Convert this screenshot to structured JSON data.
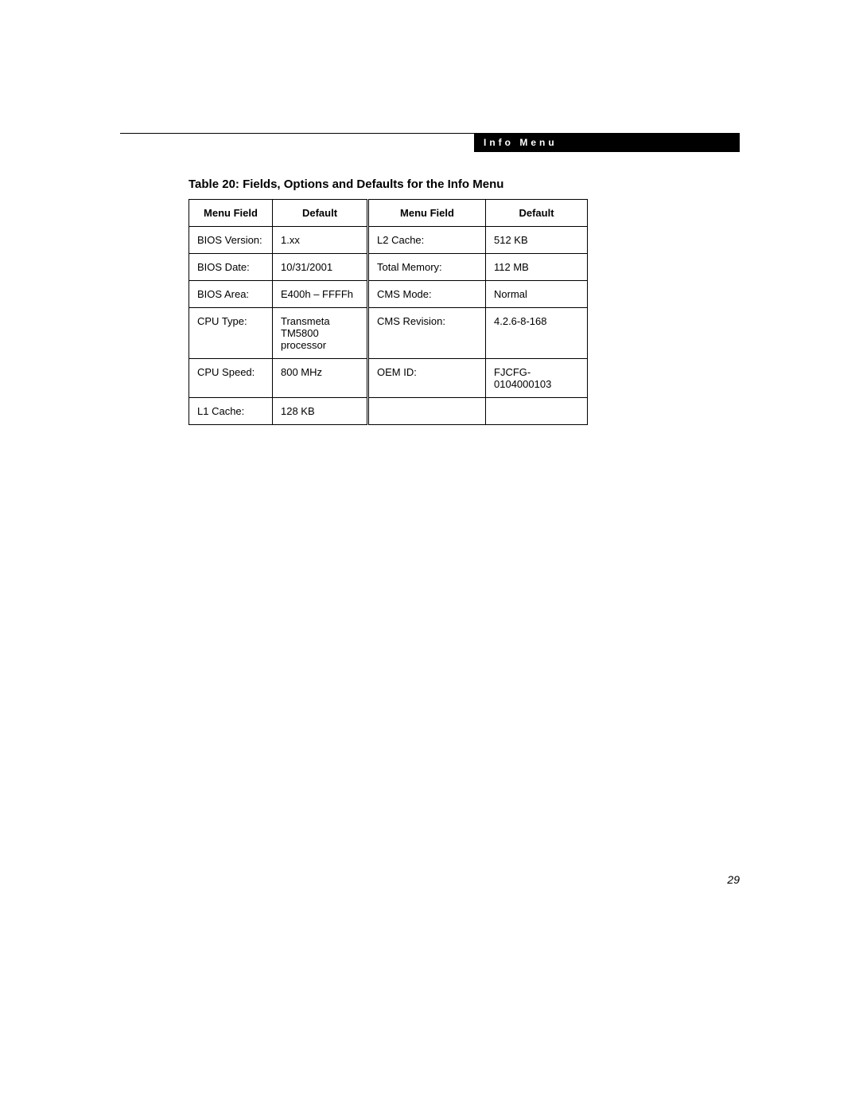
{
  "header": {
    "title": "Info Menu"
  },
  "table": {
    "caption": "Table 20: Fields, Options and Defaults for the Info Menu",
    "headers": {
      "menu_field_left": "Menu Field",
      "default_left": "Default",
      "menu_field_right": "Menu Field",
      "default_right": "Default"
    },
    "rows": [
      {
        "lf": "BIOS Version:",
        "ld": "1.xx",
        "rf": "L2 Cache:",
        "rd": "512 KB"
      },
      {
        "lf": "BIOS Date:",
        "ld": "10/31/2001",
        "rf": "Total Memory:",
        "rd": "112 MB"
      },
      {
        "lf": "BIOS Area:",
        "ld": "E400h – FFFFh",
        "rf": "CMS Mode:",
        "rd": "Normal"
      },
      {
        "lf": "CPU Type:",
        "ld": "Transmeta TM5800 processor",
        "rf": "CMS Revision:",
        "rd": "4.2.6-8-168"
      },
      {
        "lf": "CPU Speed:",
        "ld": "800 MHz",
        "rf": "OEM ID:",
        "rd": "FJCFG-0104000103"
      },
      {
        "lf": "L1 Cache:",
        "ld": "128 KB",
        "rf": "",
        "rd": ""
      }
    ]
  },
  "page_number": "29"
}
